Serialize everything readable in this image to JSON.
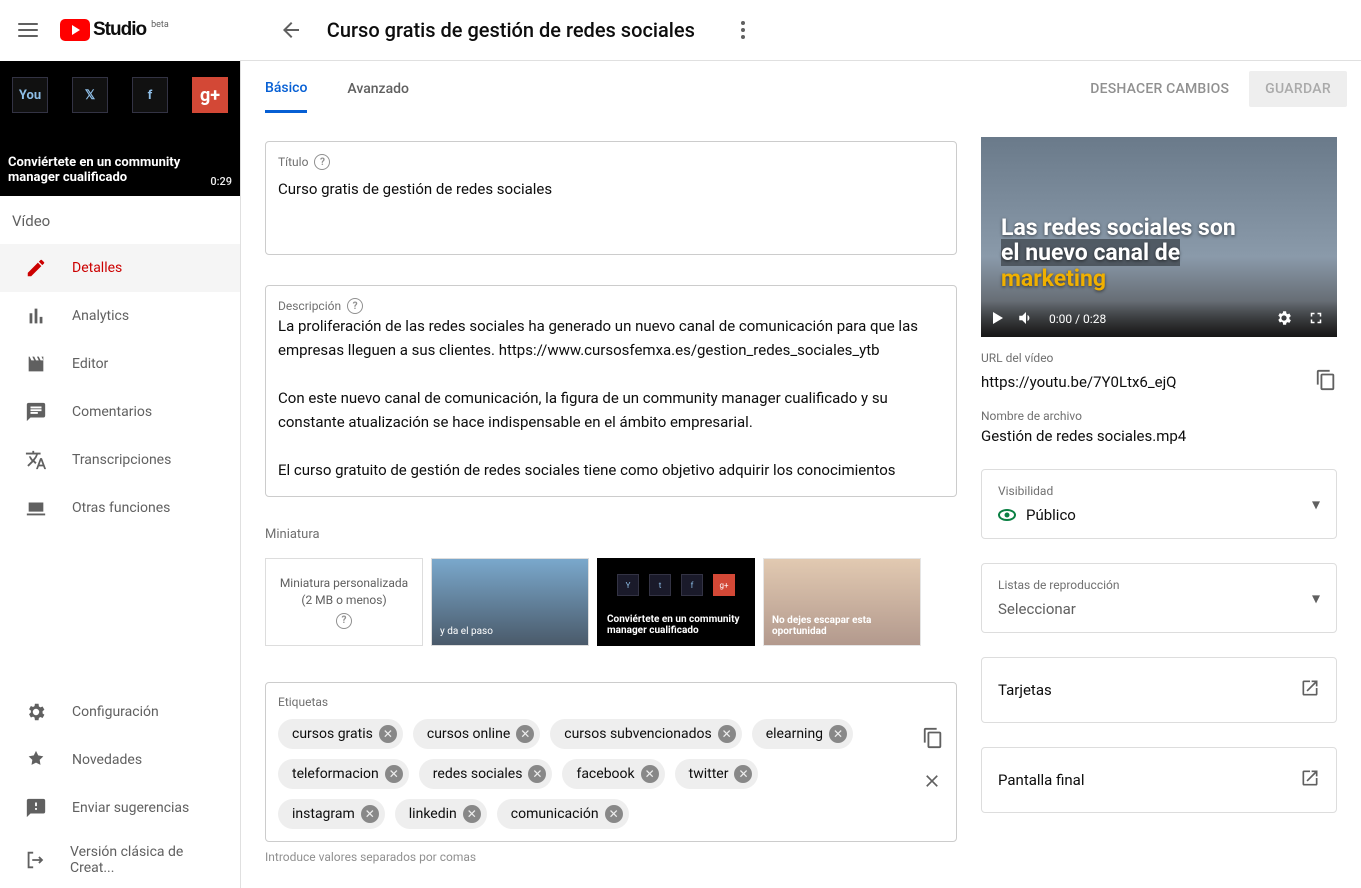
{
  "header": {
    "logo_text": "Studio",
    "logo_beta": "beta",
    "page_title": "Curso gratis de gestión de redes sociales"
  },
  "actions": {
    "undo": "DESHACER CAMBIOS",
    "save": "GUARDAR"
  },
  "sidebar": {
    "preview_duration": "0:29",
    "preview_caption": "Conviértete en un community manager cualificado",
    "section": "Vídeo",
    "items": [
      {
        "label": "Detalles"
      },
      {
        "label": "Analytics"
      },
      {
        "label": "Editor"
      },
      {
        "label": "Comentarios"
      },
      {
        "label": "Transcripciones"
      },
      {
        "label": "Otras funciones"
      }
    ],
    "footer": [
      {
        "label": "Configuración"
      },
      {
        "label": "Novedades"
      },
      {
        "label": "Enviar sugerencias"
      },
      {
        "label": "Versión clásica de Creat..."
      }
    ]
  },
  "tabs": {
    "basic": "Básico",
    "advanced": "Avanzado"
  },
  "title_field": {
    "label": "Título",
    "value": "Curso gratis de gestión de redes sociales"
  },
  "desc_field": {
    "label": "Descripción",
    "p1": "La proliferación de las redes sociales ha generado un nuevo canal de comunicación para que las empresas lleguen a sus clientes. https://www.cursosfemxa.es/gestion_redes_sociales_ytb",
    "p2": "Con este nuevo canal de comunicación, la figura de un community manager cualificado y su constante atualización se hace indispensable en el ámbito empresarial.",
    "p3": "El curso gratuito de gestión de redes sociales tiene como objetivo adquirir los conocimientos"
  },
  "miniature": {
    "label": "Miniatura",
    "custom": "Miniatura personalizada (2 MB o menos)",
    "t1_text": "y da el paso",
    "t2_text": "Conviértete en un community manager cualificado",
    "t3_text": "No dejes escapar esta oportunidad"
  },
  "tags_field": {
    "label": "Etiquetas",
    "hint": "Introduce valores separados por comas",
    "tags": [
      "cursos gratis",
      "cursos online",
      "cursos subvencionados",
      "elearning",
      "teleformacion",
      "redes sociales",
      "facebook",
      "twitter",
      "instagram",
      "linkedin",
      "comunicación"
    ]
  },
  "preview": {
    "overlay_l1": "Las redes sociales son",
    "overlay_l2": "el nuevo canal de",
    "overlay_l3": "marketing",
    "time": "0:00 / 0:28",
    "url_label": "URL del vídeo",
    "url": "https://youtu.be/7Y0Ltx6_ejQ",
    "file_label": "Nombre de archivo",
    "file": "Gestión de redes sociales.mp4"
  },
  "visibility": {
    "label": "Visibilidad",
    "value": "Público"
  },
  "playlists": {
    "label": "Listas de reproducción",
    "value": "Seleccionar"
  },
  "cards": {
    "label": "Tarjetas"
  },
  "endscreen": {
    "label": "Pantalla final"
  }
}
